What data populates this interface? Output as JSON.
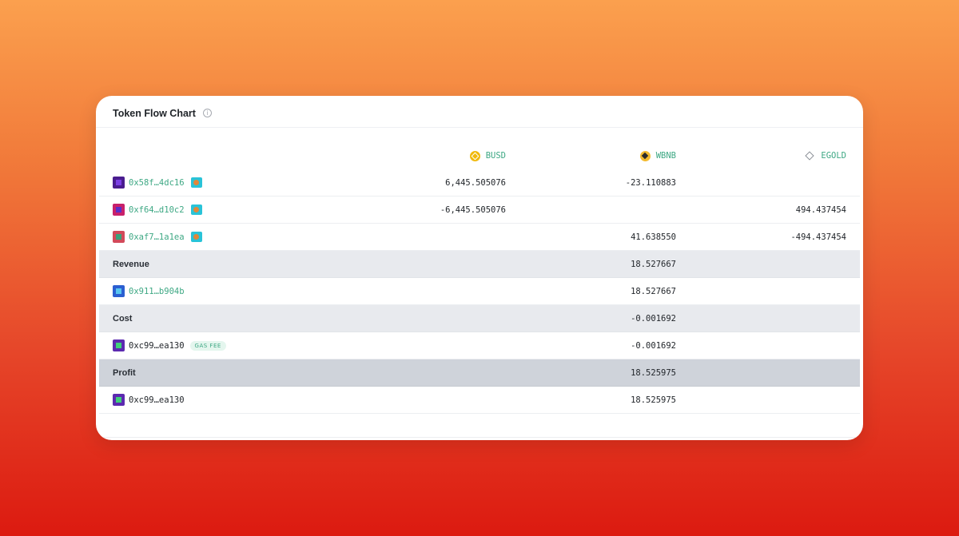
{
  "card": {
    "title": "Token Flow Chart",
    "info_glyph": "i"
  },
  "tokens": [
    {
      "symbol": "BUSD",
      "icon": "busd-coin-icon"
    },
    {
      "symbol": "WBNB",
      "icon": "wbnb-coin-icon"
    },
    {
      "symbol": "EGOLD",
      "icon": "egold-token-icon"
    }
  ],
  "rows": {
    "r1": {
      "address": "0x58f…4dc16",
      "busd": "6,445.505076",
      "wbnb": "-23.110883",
      "egold": ""
    },
    "r2": {
      "address": "0xf64…d10c2",
      "busd": "-6,445.505076",
      "wbnb": "",
      "egold": "494.437454"
    },
    "r3": {
      "address": "0xaf7…1a1ea",
      "busd": "",
      "wbnb": "41.638550",
      "egold": "-494.437454"
    },
    "revenue": {
      "label": "Revenue",
      "wbnb": "18.527667"
    },
    "r4": {
      "address": "0x911…b904b",
      "wbnb": "18.527667"
    },
    "cost": {
      "label": "Cost",
      "wbnb": "-0.001692"
    },
    "r5": {
      "address": "0xc99…ea130",
      "badge": "GAS FEE",
      "wbnb": "-0.001692"
    },
    "profit": {
      "label": "Profit",
      "wbnb": "18.525975"
    },
    "r6": {
      "address": "0xc99…ea130",
      "wbnb": "18.525975"
    }
  },
  "colors": {
    "accent_green": "#3ea884",
    "section_bg": "#e8eaee",
    "profit_bg": "#cfd3da"
  }
}
